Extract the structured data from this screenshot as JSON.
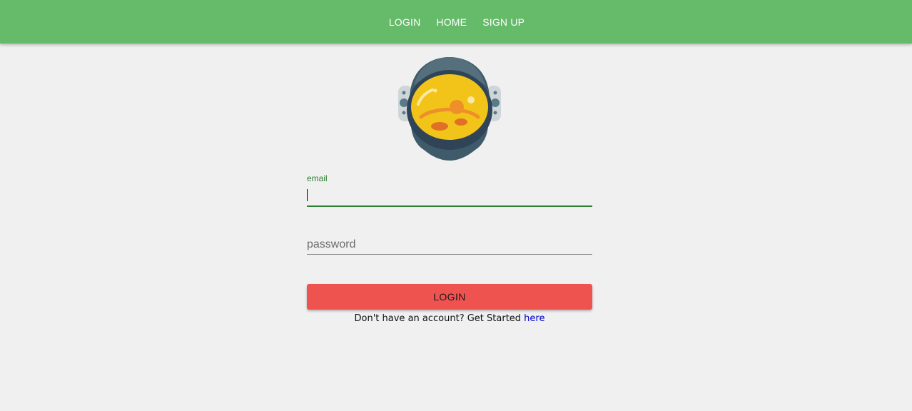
{
  "nav": {
    "items": [
      {
        "label": "LOGIN"
      },
      {
        "label": "HOME"
      },
      {
        "label": "SIGN UP"
      }
    ],
    "background": "#66bb6a"
  },
  "form": {
    "email_label": "email",
    "email_value": "",
    "password_placeholder": "password",
    "password_value": "",
    "login_button": "LOGIN",
    "button_color": "#ef5350",
    "accent_color": "#2e7d32"
  },
  "signup": {
    "prompt": "Don't have an account? Get Started ",
    "link": "here"
  },
  "avatar": {
    "icon": "astronaut-helmet-icon"
  }
}
